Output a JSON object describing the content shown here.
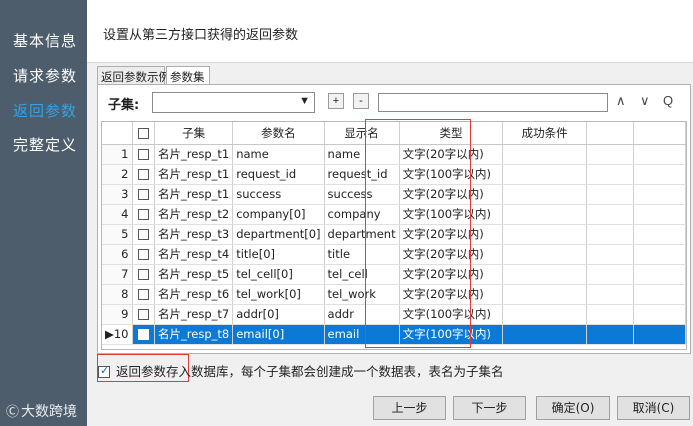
{
  "sidebar": {
    "items": [
      {
        "label": "基本信息"
      },
      {
        "label": "请求参数"
      },
      {
        "label": "返回参数"
      },
      {
        "label": "完整定义"
      }
    ],
    "watermark": "大数跨境",
    "watermark_logo": "Ⓒ"
  },
  "header": {
    "title": "设置从第三方接口获得的返回参数"
  },
  "tabs": [
    {
      "label": "返回参数示例"
    },
    {
      "label": "参数集"
    }
  ],
  "toolbar": {
    "subset_label": "子集:",
    "subset_value": "",
    "dropdown_icon": "▼",
    "add_label": "+",
    "remove_label": "-",
    "search_value": "",
    "up_icon": "∧",
    "down_icon": "∨",
    "search_icon": "Q"
  },
  "table": {
    "headers": [
      "子集",
      "参数名",
      "显示名",
      "类型",
      "成功条件"
    ],
    "rows": [
      {
        "num": "1",
        "subset": "名片_resp_t1",
        "param": "name",
        "display": "name",
        "type": "文字(20字以内)",
        "cond": ""
      },
      {
        "num": "2",
        "subset": "名片_resp_t1",
        "param": "request_id",
        "display": "request_id",
        "type": "文字(100字以内)",
        "cond": ""
      },
      {
        "num": "3",
        "subset": "名片_resp_t1",
        "param": "success",
        "display": "success",
        "type": "文字(20字以内)",
        "cond": ""
      },
      {
        "num": "4",
        "subset": "名片_resp_t2",
        "param": "company[0]",
        "display": "company",
        "type": "文字(100字以内)",
        "cond": ""
      },
      {
        "num": "5",
        "subset": "名片_resp_t3",
        "param": "department[0]",
        "display": "department",
        "type": "文字(20字以内)",
        "cond": ""
      },
      {
        "num": "6",
        "subset": "名片_resp_t4",
        "param": "title[0]",
        "display": "title",
        "type": "文字(20字以内)",
        "cond": ""
      },
      {
        "num": "7",
        "subset": "名片_resp_t5",
        "param": "tel_cell[0]",
        "display": "tel_cell",
        "type": "文字(20字以内)",
        "cond": ""
      },
      {
        "num": "8",
        "subset": "名片_resp_t6",
        "param": "tel_work[0]",
        "display": "tel_work",
        "type": "文字(20字以内)",
        "cond": ""
      },
      {
        "num": "9",
        "subset": "名片_resp_t7",
        "param": "addr[0]",
        "display": "addr",
        "type": "文字(100字以内)",
        "cond": ""
      },
      {
        "num": "▶10",
        "subset": "名片_resp_t8",
        "param": "email[0]",
        "display": "email",
        "type": "文字(100字以内)",
        "cond": ""
      }
    ]
  },
  "save_option": {
    "label": "返回参数存入数据库，每个子集都会创建成一个数据表，表名为子集名",
    "checked": true
  },
  "buttons": {
    "prev": "上一步",
    "next": "下一步",
    "ok": "确定(O)",
    "cancel": "取消(C)"
  },
  "colors": {
    "sidebar": "#4e5d6c",
    "active": "#2fa4e7",
    "selected_row": "#0a7ad6",
    "highlight": "#e03b3b"
  }
}
